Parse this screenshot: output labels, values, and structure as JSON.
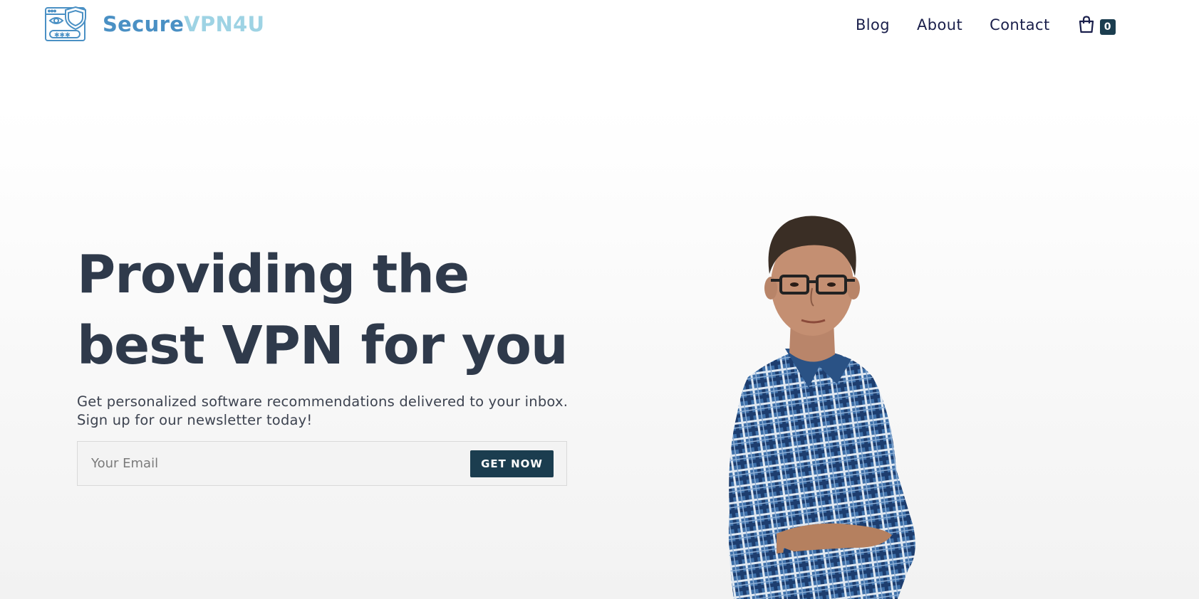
{
  "brand": {
    "name_part1": "Secure",
    "name_part2": "VPN4U",
    "logo_icon": "browser-shield-eye-password-icon",
    "colors": {
      "primary": "#4a90c4",
      "secondary": "#9ed3e4"
    }
  },
  "nav": {
    "items": [
      {
        "label": "Blog"
      },
      {
        "label": "About"
      },
      {
        "label": "Contact"
      }
    ],
    "cart": {
      "icon": "shopping-bag-icon",
      "count": "0"
    }
  },
  "hero": {
    "title_line1": "Providing the",
    "title_line2": "best VPN for you",
    "subtitle_line1": "Get personalized software recommendations delivered to your inbox.",
    "subtitle_line2": "Sign up for our newsletter today!",
    "email_placeholder": "Your Email",
    "email_value": "",
    "cta_label": "GET NOW"
  },
  "colors": {
    "heading": "#2f3a4b",
    "nav_text": "#1a1f4b",
    "button_bg": "#1b3d4f",
    "button_text": "#ffffff"
  }
}
